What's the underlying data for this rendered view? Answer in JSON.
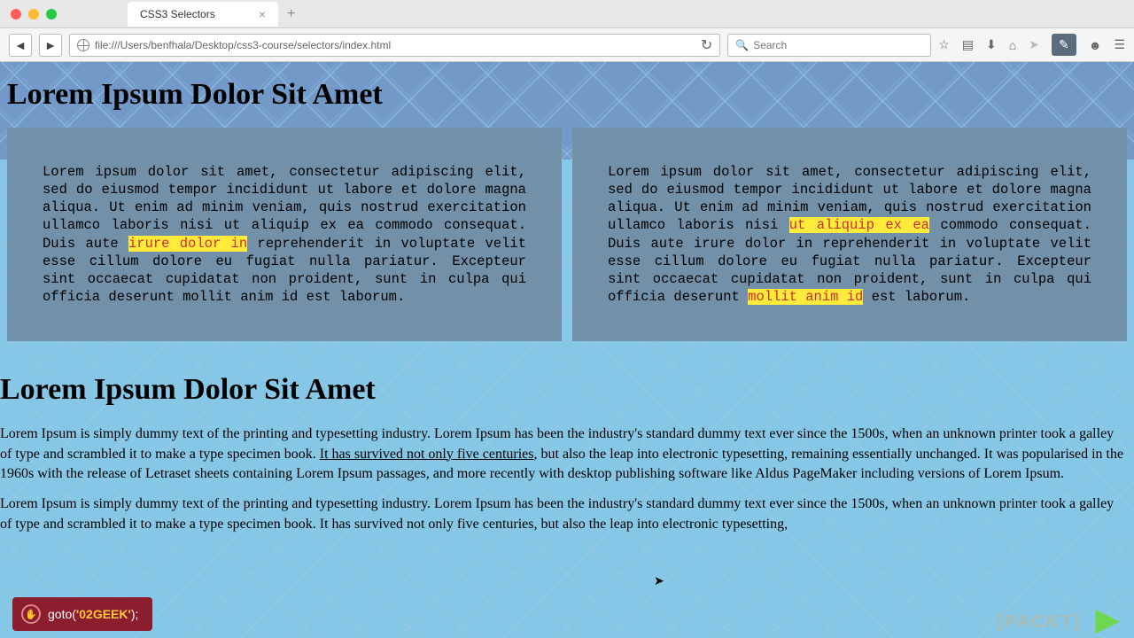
{
  "window": {
    "tab_title": "CSS3 Selectors"
  },
  "toolbar": {
    "url": "file:///Users/benfhala/Desktop/css3-course/selectors/index.html",
    "search_placeholder": "Search"
  },
  "page": {
    "heading1": "Lorem Ipsum Dolor Sit Amet",
    "box1_before": "Lorem ipsum dolor sit amet, consectetur adipiscing elit, sed do eiusmod tempor incididunt ut labore et dolore magna aliqua. Ut enim ad minim veniam, quis nostrud exercitation ullamco laboris nisi ut aliquip ex ea commodo consequat. Duis aute ",
    "box1_hl": "irure dolor in",
    "box1_after": " reprehenderit in voluptate velit esse cillum dolore eu fugiat nulla pariatur. Excepteur sint occaecat cupidatat non proident, sunt in culpa qui officia deserunt mollit anim id est laborum.",
    "box2_a": "Lorem ipsum dolor sit amet, consectetur adipiscing elit, sed do eiusmod tempor incididunt ut labore et dolore magna aliqua. Ut enim ad minim veniam, quis nostrud exercitation ullamco laboris nisi ",
    "box2_hl1": "ut aliquip ex ea",
    "box2_b": " commodo consequat. Duis aute irure dolor in reprehenderit in voluptate velit esse cillum dolore eu fugiat nulla pariatur. Excepteur sint occaecat cupidatat non proident, sunt in culpa qui officia deserunt ",
    "box2_hl2": "mollit anim id",
    "box2_c": " est laborum.",
    "heading2": "Lorem Ipsum Dolor Sit Amet",
    "para_a": "Lorem Ipsum is simply dummy text of the printing and typesetting industry. Lorem Ipsum has been the industry's standard dummy text ever since the 1500s, when an unknown printer took a galley of type and scrambled it to make a type specimen book. ",
    "para_u": "It has survived not only five centuries",
    "para_b": ", but also the leap into electronic typesetting, remaining essentially unchanged. It was popularised in the 1960s with the release of Letraset sheets containing Lorem Ipsum passages, and more recently with desktop publishing software like Aldus PageMaker including versions of Lorem Ipsum.",
    "para2": "Lorem Ipsum is simply dummy text of the printing and typesetting industry. Lorem Ipsum has been the industry's standard dummy text ever since the 1500s, when an unknown printer took a galley of type and scrambled it to make a type specimen book. It has survived not only five centuries, but also the leap into electronic typesetting,"
  },
  "playbar": {
    "prefix": "goto(",
    "string": "'02GEEK'",
    "suffix": ");"
  },
  "watermark": "[PACKT]"
}
